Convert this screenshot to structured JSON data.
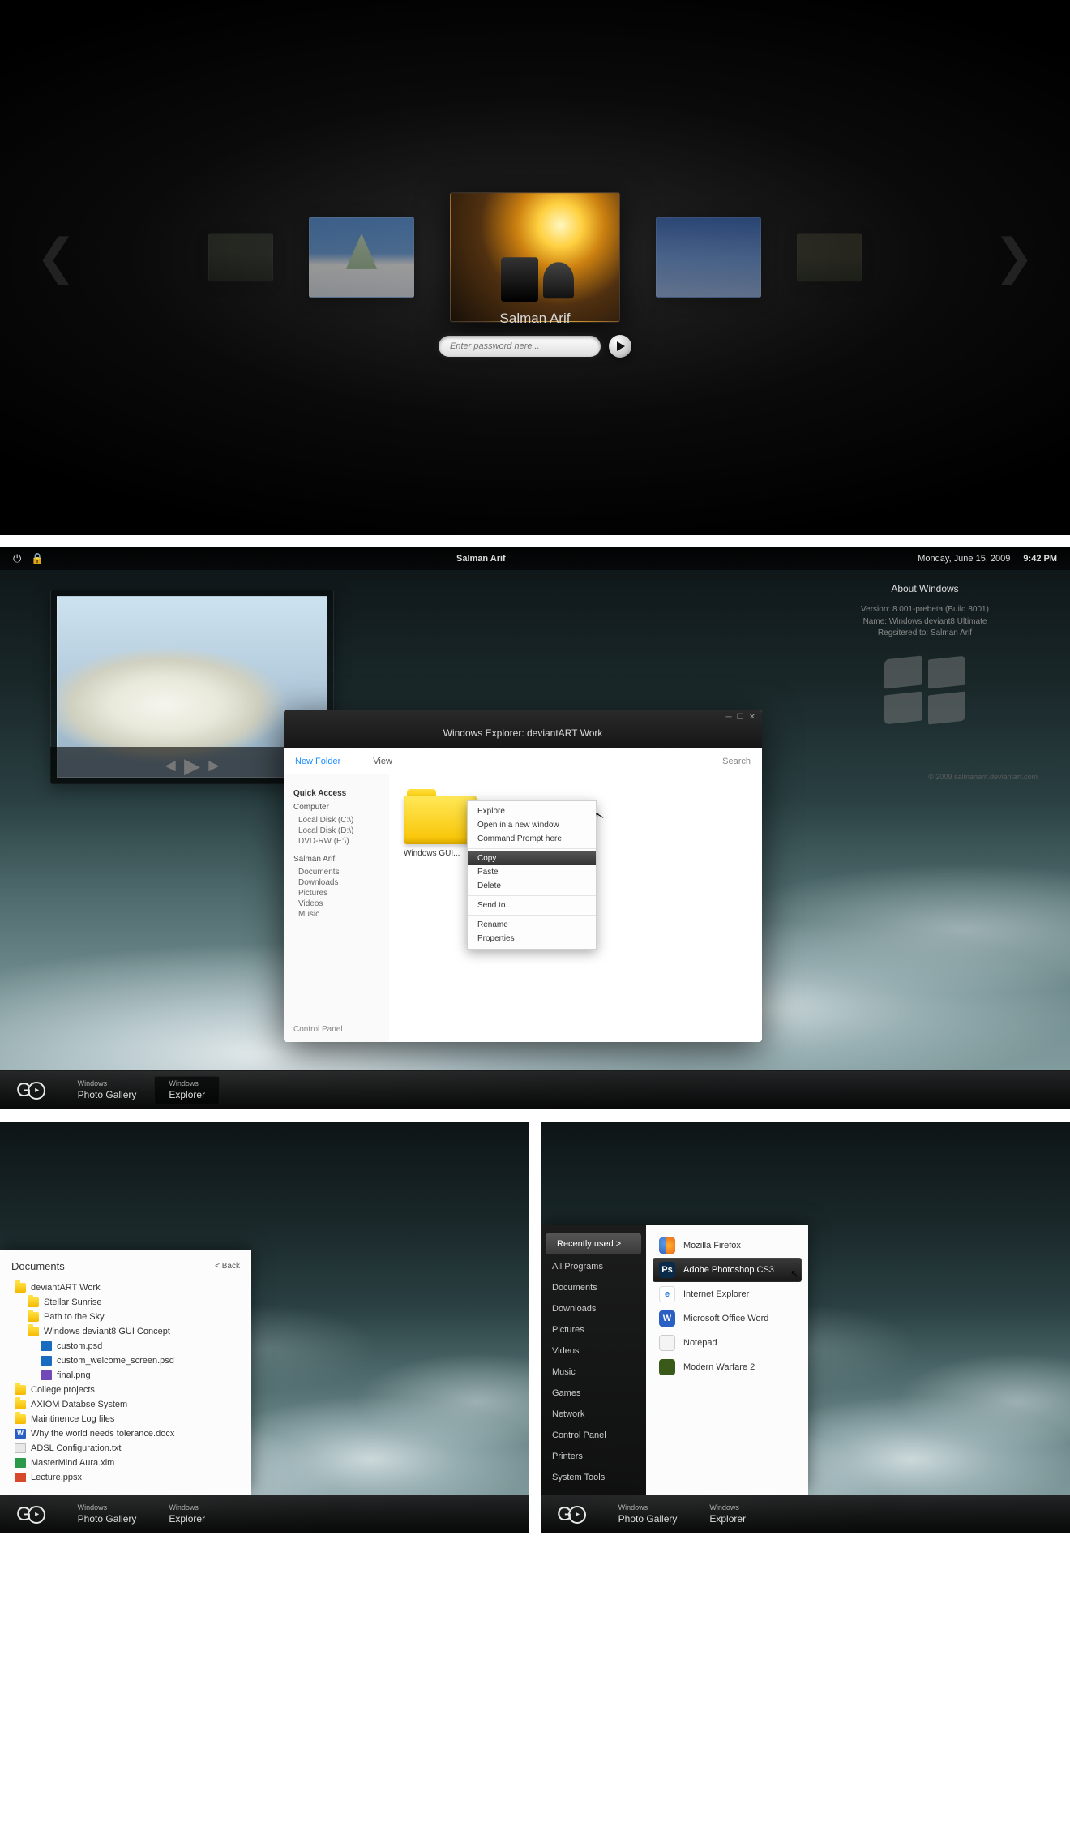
{
  "login": {
    "username": "Salman Arif",
    "placeholder": "Enter password here..."
  },
  "topbar": {
    "username": "Salman Arif",
    "date": "Monday, June 15, 2009",
    "time": "9:42 PM"
  },
  "about": {
    "title": "About Windows",
    "line1": "Version: 8.001-prebeta (Build 8001)",
    "line2": "Name: Windows deviant8 Ultimate",
    "line3": "Regsitered to: Salman Arif",
    "credit": "© 2009 salmanarif.deviantart.com"
  },
  "explorer": {
    "title": "Windows Explorer: deviantART Work",
    "toolbar": {
      "newFolder": "New Folder",
      "view": "View",
      "search": "Search"
    },
    "qa": {
      "heading": "Quick Access",
      "groupComputer": "Computer",
      "drives": [
        "Local Disk (C:\\)",
        "Local Disk (D:\\)",
        "DVD-RW (E:\\)"
      ],
      "groupUser": "Salman Arif",
      "userFolders": [
        "Documents",
        "Downloads",
        "Pictures",
        "Videos",
        "Music"
      ],
      "controlPanel": "Control Panel"
    },
    "folderLabel": "Windows GUI...",
    "context": [
      "Explore",
      "Open in a new window",
      "Command Prompt here",
      "Copy",
      "Paste",
      "Delete",
      "Send to...",
      "Rename",
      "Properties"
    ],
    "contextHighlightIndex": 3
  },
  "taskbar": {
    "app1Top": "Windows",
    "app1Bot": "Photo Gallery",
    "app2Top": "Windows",
    "app2Bot": "Explorer"
  },
  "startNavDocs": "Documents",
  "startNav": [
    "Recently used >",
    "All Programs",
    "Documents",
    "Downloads",
    "Pictures",
    "Videos",
    "Music",
    "Games",
    "Network",
    "Control Panel",
    "Printers",
    "System Tools"
  ],
  "docPanel": {
    "title": "Documents",
    "back": "< Back",
    "items": [
      {
        "t": "folder",
        "n": "deviantART Work",
        "children": [
          {
            "t": "folder",
            "n": "Stellar Sunrise"
          },
          {
            "t": "folder",
            "n": "Path to the Sky"
          },
          {
            "t": "folder",
            "n": "Windows deviant8 GUI Concept",
            "children": [
              {
                "t": "psd",
                "n": "custom.psd"
              },
              {
                "t": "psd",
                "n": "custom_welcome_screen.psd"
              },
              {
                "t": "png",
                "n": "final.png"
              }
            ]
          }
        ]
      },
      {
        "t": "folder",
        "n": "College projects"
      },
      {
        "t": "folder",
        "n": "AXIOM Databse System"
      },
      {
        "t": "folder",
        "n": "Maintinence Log files"
      },
      {
        "t": "docx",
        "n": "Why the world needs tolerance.docx"
      },
      {
        "t": "txt",
        "n": "ADSL Configuration.txt"
      },
      {
        "t": "xlm",
        "n": "MasterMind Aura.xlm"
      },
      {
        "t": "ppsx",
        "n": "Lecture.ppsx"
      }
    ]
  },
  "appPanel": {
    "selectedNavIndex": 0,
    "apps": [
      {
        "ico": "ff",
        "n": "Mozilla Firefox"
      },
      {
        "ico": "ps",
        "n": "Adobe Photoshop CS3",
        "sel": true,
        "label": "Ps"
      },
      {
        "ico": "ie",
        "n": "Internet Explorer",
        "label": "e"
      },
      {
        "ico": "word",
        "n": "Microsoft Office Word",
        "label": "W"
      },
      {
        "ico": "np",
        "n": "Notepad"
      },
      {
        "ico": "mw",
        "n": "Modern Warfare 2"
      }
    ]
  }
}
